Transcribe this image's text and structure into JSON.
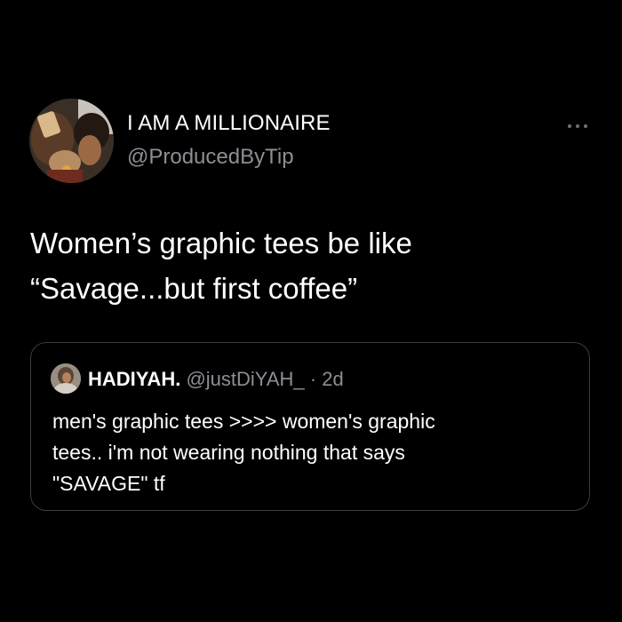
{
  "tweet": {
    "author": {
      "display_name": "I AM A MILLIONAIRE",
      "handle": "@ProducedByTip",
      "avatar_icon": "profile-photo"
    },
    "more_icon": "ellipsis-icon",
    "text_lines": [
      "Women’s graphic tees be like",
      "“Savage...but first coffee”"
    ]
  },
  "quoted_tweet": {
    "author": {
      "display_name": "HADIYAH.",
      "handle": "@justDiYAH_",
      "separator": "·",
      "time": "2d"
    },
    "text_lines": [
      "men's graphic tees >>>> women's graphic",
      "tees.. i'm not wearing nothing that says",
      "\"SAVAGE\" tf"
    ]
  },
  "colors": {
    "background": "#000000",
    "primary_text": "#ffffff",
    "secondary_text": "#8b8f94",
    "card_border": "#3a3d40"
  }
}
